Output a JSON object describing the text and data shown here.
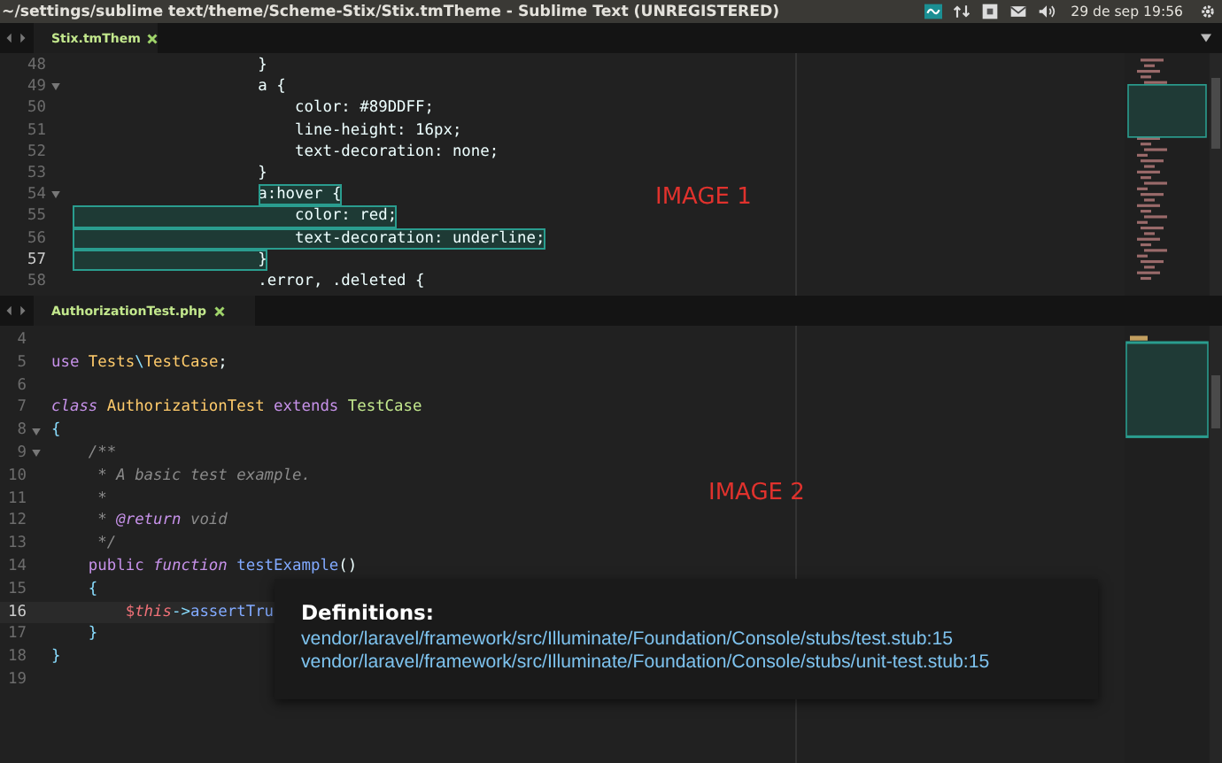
{
  "window": {
    "title": "~/settings/sublime text/theme/Scheme-Stix/Stix.tmTheme - Sublime Text (UNREGISTERED)"
  },
  "tray": {
    "clock": "29 de sep 19:56"
  },
  "panes": [
    {
      "tab": {
        "label": "Stix.tmThem",
        "selected": true
      },
      "overlay_label": "IMAGE 1",
      "lines": [
        {
          "n": "48",
          "fold": false,
          "current": false,
          "tokens": [
            {
              "t": "                    }",
              "kind": "plain",
              "selected": false
            }
          ]
        },
        {
          "n": "49",
          "fold": true,
          "current": false,
          "tokens": [
            {
              "t": "                    a {",
              "kind": "plain",
              "selected": false
            }
          ]
        },
        {
          "n": "50",
          "fold": false,
          "current": false,
          "tokens": [
            {
              "t": "                        color: #89DDFF;",
              "kind": "plain",
              "selected": false
            }
          ]
        },
        {
          "n": "51",
          "fold": false,
          "current": false,
          "tokens": [
            {
              "t": "                        line-height: 16px;",
              "kind": "plain",
              "selected": false
            }
          ]
        },
        {
          "n": "52",
          "fold": false,
          "current": false,
          "tokens": [
            {
              "t": "                        text-decoration: none;",
              "kind": "plain",
              "selected": false
            }
          ]
        },
        {
          "n": "53",
          "fold": false,
          "current": false,
          "tokens": [
            {
              "t": "                    }",
              "kind": "plain",
              "selected": false
            }
          ]
        },
        {
          "n": "54",
          "fold": true,
          "current": false,
          "tokens": [
            {
              "t": "                    a:hover {",
              "kind": "plain",
              "selected": true
            }
          ]
        },
        {
          "n": "55",
          "fold": false,
          "current": false,
          "tokens": [
            {
              "t": "                        color: red;",
              "kind": "plain",
              "selected": true
            }
          ]
        },
        {
          "n": "56",
          "fold": false,
          "current": false,
          "tokens": [
            {
              "t": "                        text-decoration: underline;",
              "kind": "plain",
              "selected": true
            }
          ]
        },
        {
          "n": "57",
          "fold": false,
          "current": true,
          "tokens": [
            {
              "t": "                    }",
              "kind": "plain",
              "selected": true
            }
          ]
        },
        {
          "n": "58",
          "fold": false,
          "current": false,
          "tokens": [
            {
              "t": "                    .error, .deleted {",
              "kind": "plain",
              "selected": false
            }
          ]
        }
      ]
    },
    {
      "tab": {
        "label": "AuthorizationTest.php",
        "selected": true
      },
      "overlay_label": "IMAGE 2",
      "lines": [
        {
          "n": "4",
          "fold": false,
          "current": false
        },
        {
          "n": "5",
          "fold": false,
          "current": false,
          "tokens": [
            {
              "t": "use",
              "kind": "keyword",
              "selected": false
            },
            {
              "t": " Tests",
              "kind": "type",
              "selected": false
            },
            {
              "t": "\\",
              "kind": "punct",
              "selected": false
            },
            {
              "t": "TestCase",
              "kind": "type",
              "selected": false
            },
            {
              "t": ";",
              "kind": "plain",
              "selected": false
            }
          ]
        },
        {
          "n": "6",
          "fold": false,
          "current": false
        },
        {
          "n": "7",
          "fold": false,
          "current": false,
          "tokens": [
            {
              "t": "class",
              "kind": "storage",
              "selected": false
            },
            {
              "t": " AuthorizationTest",
              "kind": "type",
              "selected": false
            },
            {
              "t": " extends",
              "kind": "keyword",
              "selected": false
            },
            {
              "t": " TestCase",
              "kind": "inherited",
              "selected": false
            }
          ]
        },
        {
          "n": "8",
          "fold": true,
          "current": false,
          "tokens": [
            {
              "t": "{",
              "kind": "punct",
              "selected": false
            }
          ]
        },
        {
          "n": "9",
          "fold": true,
          "current": false,
          "tokens": [
            {
              "t": "    /**",
              "kind": "comment",
              "selected": false
            }
          ]
        },
        {
          "n": "10",
          "fold": false,
          "current": false,
          "tokens": [
            {
              "t": "     * A basic test example.",
              "kind": "comment",
              "selected": false
            }
          ]
        },
        {
          "n": "11",
          "fold": false,
          "current": false,
          "tokens": [
            {
              "t": "     *",
              "kind": "comment",
              "selected": false
            }
          ]
        },
        {
          "n": "12",
          "fold": false,
          "current": false,
          "tokens": [
            {
              "t": "     *",
              "kind": "comment",
              "selected": false
            },
            {
              "t": " @return",
              "kind": "storage",
              "selected": false
            },
            {
              "t": " void",
              "kind": "comment",
              "selected": false
            }
          ]
        },
        {
          "n": "13",
          "fold": false,
          "current": false,
          "tokens": [
            {
              "t": "     */",
              "kind": "comment",
              "selected": false
            }
          ]
        },
        {
          "n": "14",
          "fold": false,
          "current": false,
          "tokens": [
            {
              "t": "    public",
              "kind": "keyword",
              "selected": false
            },
            {
              "t": " function",
              "kind": "storage",
              "selected": false
            },
            {
              "t": " testExample",
              "kind": "function",
              "selected": false
            },
            {
              "t": "()",
              "kind": "plain",
              "selected": false
            }
          ]
        },
        {
          "n": "15",
          "fold": false,
          "current": false,
          "tokens": [
            {
              "t": "    {",
              "kind": "punct",
              "selected": false
            }
          ]
        },
        {
          "n": "16",
          "fold": false,
          "current": true,
          "tokens": [
            {
              "t": "        $",
              "kind": "variable",
              "selected": false
            },
            {
              "t": "this",
              "kind": "this",
              "selected": false
            },
            {
              "t": "->",
              "kind": "punct",
              "selected": false
            },
            {
              "t": "assertTru",
              "kind": "function",
              "selected": false
            }
          ]
        },
        {
          "n": "17",
          "fold": false,
          "current": false,
          "tokens": [
            {
              "t": "    }",
              "kind": "punct",
              "selected": false
            }
          ]
        },
        {
          "n": "18",
          "fold": false,
          "current": false,
          "tokens": [
            {
              "t": "}",
              "kind": "punct",
              "selected": false
            }
          ]
        },
        {
          "n": "19",
          "fold": false,
          "current": false
        }
      ]
    }
  ],
  "popup": {
    "title": "Definitions:",
    "links": [
      "vendor/laravel/framework/src/Illuminate/Foundation/Console/stubs/test.stub:15",
      "vendor/laravel/framework/src/Illuminate/Foundation/Console/stubs/unit-test.stub:15"
    ]
  }
}
